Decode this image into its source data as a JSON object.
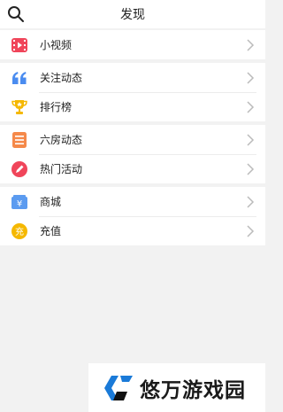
{
  "header": {
    "title": "发现",
    "search_icon": "search-icon"
  },
  "groups": [
    {
      "items": [
        {
          "label": "小视频",
          "icon": "video-icon",
          "color": "#f0455a"
        }
      ]
    },
    {
      "items": [
        {
          "label": "关注动态",
          "icon": "quote-icon",
          "color": "#4a8cf0"
        },
        {
          "label": "排行榜",
          "icon": "trophy-icon",
          "color": "#f5b800"
        }
      ]
    },
    {
      "items": [
        {
          "label": "六房动态",
          "icon": "list-icon",
          "color": "#f5894a"
        },
        {
          "label": "热门活动",
          "icon": "pen-icon",
          "color": "#f0455a"
        }
      ]
    },
    {
      "items": [
        {
          "label": "商城",
          "icon": "shop-icon",
          "color": "#5b9bf0"
        },
        {
          "label": "充值",
          "icon": "recharge-icon",
          "color": "#f5b800",
          "glyph": "充"
        }
      ]
    }
  ],
  "shop_glyph": "¥",
  "watermark": {
    "text": "悠万游戏园"
  }
}
